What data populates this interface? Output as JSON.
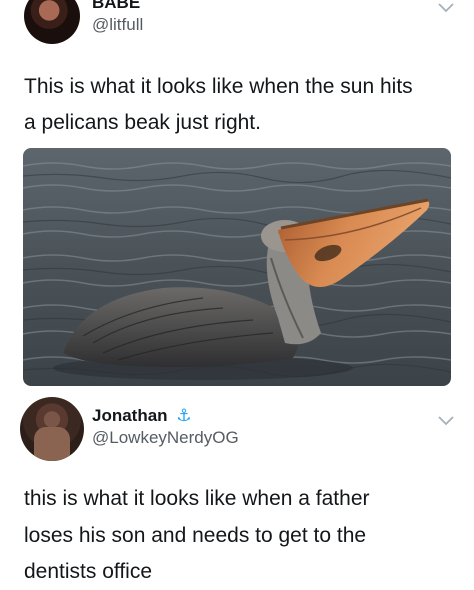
{
  "tweet_1": {
    "display_name": "BABE",
    "handle": "@litfull",
    "text_line_1": "This is what it looks like when the sun hits",
    "text_line_2": "a pelicans beak just right."
  },
  "tweet_2": {
    "display_name": "Jonathan",
    "name_emoji": "⚓",
    "handle": "@LowkeyNerdyOG",
    "text_line_1": "this is what it looks like when a father",
    "text_line_2": "loses his son and needs to get to the",
    "text_line_3": "dentists office"
  },
  "colors": {
    "text": "#14171a",
    "handle": "#555c63",
    "water": "#4b535a",
    "beak": "#c77a44",
    "pelican_body": "#4a4a4c"
  },
  "icons": [
    "chevron-down-icon",
    "anchor-icon",
    "avatar-photo",
    "pelican-photo"
  ]
}
